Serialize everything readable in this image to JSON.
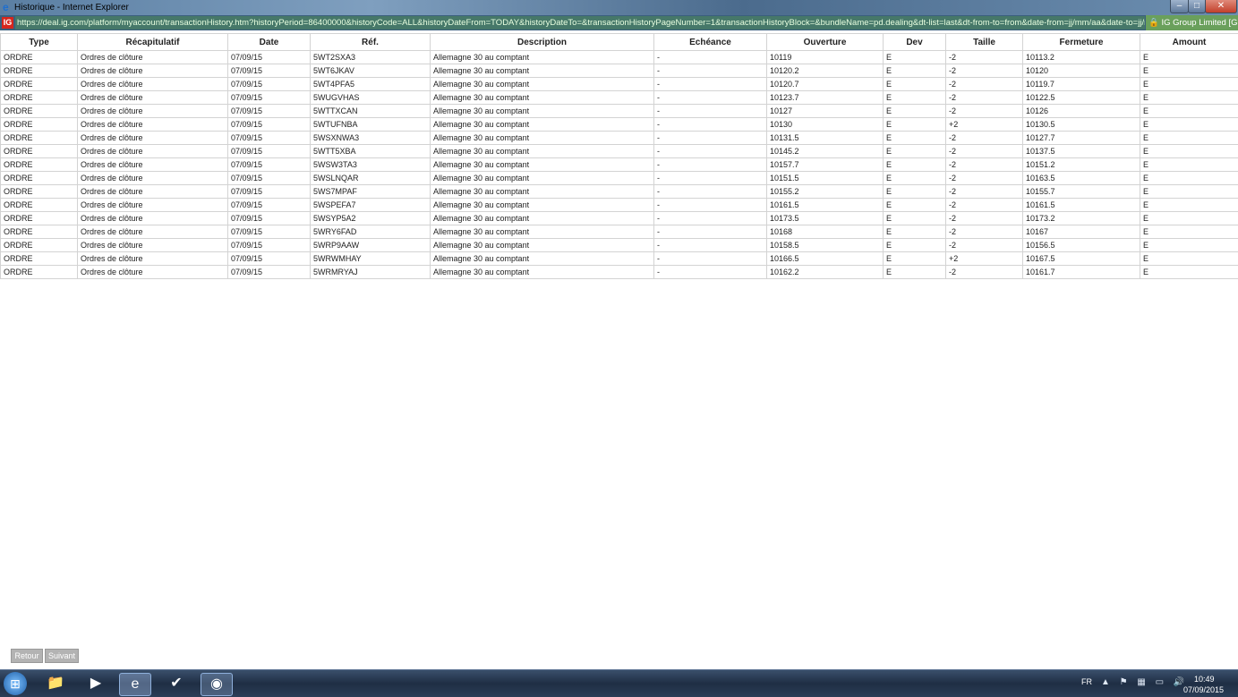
{
  "window": {
    "title": "Historique - Internet Explorer",
    "minimize": "–",
    "maximize": "□",
    "close": "✕"
  },
  "address_bar": {
    "logo": "IG",
    "url": "https://deal.ig.com/platform/myaccount/transactionHistory.htm?historyPeriod=86400000&historyCode=ALL&historyDateFrom=TODAY&historyDateTo=&transactionHistoryPageNumber=1&transactionHistoryBlock=&bundleName=pd.dealing&dt-list=last&dt-from-to=from&date-from=jj/mm/aa&date-to=jj/mm/",
    "certificate": "IG Group Limited [GB]"
  },
  "table": {
    "headers": [
      "Type",
      "Récapitulatif",
      "Date",
      "Réf.",
      "Description",
      "Echéance",
      "Ouverture",
      "Dev",
      "Taille",
      "Fermeture",
      "Amount"
    ],
    "rows": [
      [
        "ORDRE",
        "Ordres de clôture",
        "07/09/15",
        "5WT2SXA3",
        "Allemagne 30 au comptant",
        "-",
        "10119",
        "E",
        "-2",
        "10113.2",
        "E"
      ],
      [
        "ORDRE",
        "Ordres de clôture",
        "07/09/15",
        "5WT6JKAV",
        "Allemagne 30 au comptant",
        "-",
        "10120.2",
        "E",
        "-2",
        "10120",
        "E"
      ],
      [
        "ORDRE",
        "Ordres de clôture",
        "07/09/15",
        "5WT4PFA5",
        "Allemagne 30 au comptant",
        "-",
        "10120.7",
        "E",
        "-2",
        "10119.7",
        "E"
      ],
      [
        "ORDRE",
        "Ordres de clôture",
        "07/09/15",
        "5WUGVHAS",
        "Allemagne 30 au comptant",
        "-",
        "10123.7",
        "E",
        "-2",
        "10122.5",
        "E"
      ],
      [
        "ORDRE",
        "Ordres de clôture",
        "07/09/15",
        "5WTTXCAN",
        "Allemagne 30 au comptant",
        "-",
        "10127",
        "E",
        "-2",
        "10126",
        "E"
      ],
      [
        "ORDRE",
        "Ordres de clôture",
        "07/09/15",
        "5WTUFNBA",
        "Allemagne 30 au comptant",
        "-",
        "10130",
        "E",
        "+2",
        "10130.5",
        "E"
      ],
      [
        "ORDRE",
        "Ordres de clôture",
        "07/09/15",
        "5WSXNWA3",
        "Allemagne 30 au comptant",
        "-",
        "10131.5",
        "E",
        "-2",
        "10127.7",
        "E"
      ],
      [
        "ORDRE",
        "Ordres de clôture",
        "07/09/15",
        "5WTT5XBA",
        "Allemagne 30 au comptant",
        "-",
        "10145.2",
        "E",
        "-2",
        "10137.5",
        "E"
      ],
      [
        "ORDRE",
        "Ordres de clôture",
        "07/09/15",
        "5WSW3TA3",
        "Allemagne 30 au comptant",
        "-",
        "10157.7",
        "E",
        "-2",
        "10151.2",
        "E"
      ],
      [
        "ORDRE",
        "Ordres de clôture",
        "07/09/15",
        "5WSLNQAR",
        "Allemagne 30 au comptant",
        "-",
        "10151.5",
        "E",
        "-2",
        "10163.5",
        "E"
      ],
      [
        "ORDRE",
        "Ordres de clôture",
        "07/09/15",
        "5WS7MPAF",
        "Allemagne 30 au comptant",
        "-",
        "10155.2",
        "E",
        "-2",
        "10155.7",
        "E"
      ],
      [
        "ORDRE",
        "Ordres de clôture",
        "07/09/15",
        "5WSPEFA7",
        "Allemagne 30 au comptant",
        "-",
        "10161.5",
        "E",
        "-2",
        "10161.5",
        "E"
      ],
      [
        "ORDRE",
        "Ordres de clôture",
        "07/09/15",
        "5WSYP5A2",
        "Allemagne 30 au comptant",
        "-",
        "10173.5",
        "E",
        "-2",
        "10173.2",
        "E"
      ],
      [
        "ORDRE",
        "Ordres de clôture",
        "07/09/15",
        "5WRY6FAD",
        "Allemagne 30 au comptant",
        "-",
        "10168",
        "E",
        "-2",
        "10167",
        "E"
      ],
      [
        "ORDRE",
        "Ordres de clôture",
        "07/09/15",
        "5WRP9AAW",
        "Allemagne 30 au comptant",
        "-",
        "10158.5",
        "E",
        "-2",
        "10156.5",
        "E"
      ],
      [
        "ORDRE",
        "Ordres de clôture",
        "07/09/15",
        "5WRWMHAY",
        "Allemagne 30 au comptant",
        "-",
        "10166.5",
        "E",
        "+2",
        "10167.5",
        "E"
      ],
      [
        "ORDRE",
        "Ordres de clôture",
        "07/09/15",
        "5WRMRYAJ",
        "Allemagne 30 au comptant",
        "-",
        "10162.2",
        "E",
        "-2",
        "10161.7",
        "E"
      ]
    ]
  },
  "buttons": {
    "back": "Retour",
    "next": "Suivant"
  },
  "taskbar": {
    "language": "FR",
    "time": "10:49",
    "date": "07/09/2015",
    "tray_icons": "▲ ⚑ ▦ ▭ 🔊"
  }
}
